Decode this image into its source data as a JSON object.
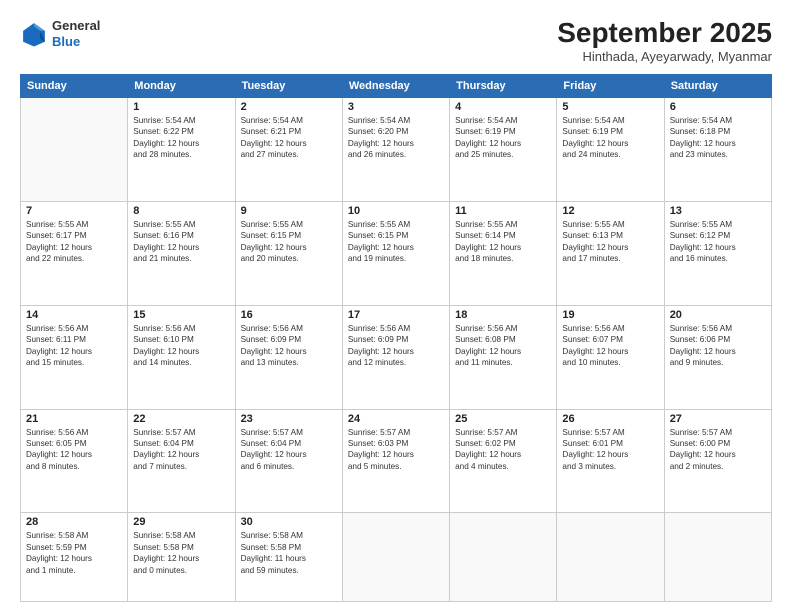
{
  "logo": {
    "general": "General",
    "blue": "Blue"
  },
  "header": {
    "month": "September 2025",
    "location": "Hinthada, Ayeyarwady, Myanmar"
  },
  "weekdays": [
    "Sunday",
    "Monday",
    "Tuesday",
    "Wednesday",
    "Thursday",
    "Friday",
    "Saturday"
  ],
  "weeks": [
    [
      {
        "day": "",
        "info": ""
      },
      {
        "day": "1",
        "info": "Sunrise: 5:54 AM\nSunset: 6:22 PM\nDaylight: 12 hours\nand 28 minutes."
      },
      {
        "day": "2",
        "info": "Sunrise: 5:54 AM\nSunset: 6:21 PM\nDaylight: 12 hours\nand 27 minutes."
      },
      {
        "day": "3",
        "info": "Sunrise: 5:54 AM\nSunset: 6:20 PM\nDaylight: 12 hours\nand 26 minutes."
      },
      {
        "day": "4",
        "info": "Sunrise: 5:54 AM\nSunset: 6:19 PM\nDaylight: 12 hours\nand 25 minutes."
      },
      {
        "day": "5",
        "info": "Sunrise: 5:54 AM\nSunset: 6:19 PM\nDaylight: 12 hours\nand 24 minutes."
      },
      {
        "day": "6",
        "info": "Sunrise: 5:54 AM\nSunset: 6:18 PM\nDaylight: 12 hours\nand 23 minutes."
      }
    ],
    [
      {
        "day": "7",
        "info": "Sunrise: 5:55 AM\nSunset: 6:17 PM\nDaylight: 12 hours\nand 22 minutes."
      },
      {
        "day": "8",
        "info": "Sunrise: 5:55 AM\nSunset: 6:16 PM\nDaylight: 12 hours\nand 21 minutes."
      },
      {
        "day": "9",
        "info": "Sunrise: 5:55 AM\nSunset: 6:15 PM\nDaylight: 12 hours\nand 20 minutes."
      },
      {
        "day": "10",
        "info": "Sunrise: 5:55 AM\nSunset: 6:15 PM\nDaylight: 12 hours\nand 19 minutes."
      },
      {
        "day": "11",
        "info": "Sunrise: 5:55 AM\nSunset: 6:14 PM\nDaylight: 12 hours\nand 18 minutes."
      },
      {
        "day": "12",
        "info": "Sunrise: 5:55 AM\nSunset: 6:13 PM\nDaylight: 12 hours\nand 17 minutes."
      },
      {
        "day": "13",
        "info": "Sunrise: 5:55 AM\nSunset: 6:12 PM\nDaylight: 12 hours\nand 16 minutes."
      }
    ],
    [
      {
        "day": "14",
        "info": "Sunrise: 5:56 AM\nSunset: 6:11 PM\nDaylight: 12 hours\nand 15 minutes."
      },
      {
        "day": "15",
        "info": "Sunrise: 5:56 AM\nSunset: 6:10 PM\nDaylight: 12 hours\nand 14 minutes."
      },
      {
        "day": "16",
        "info": "Sunrise: 5:56 AM\nSunset: 6:09 PM\nDaylight: 12 hours\nand 13 minutes."
      },
      {
        "day": "17",
        "info": "Sunrise: 5:56 AM\nSunset: 6:09 PM\nDaylight: 12 hours\nand 12 minutes."
      },
      {
        "day": "18",
        "info": "Sunrise: 5:56 AM\nSunset: 6:08 PM\nDaylight: 12 hours\nand 11 minutes."
      },
      {
        "day": "19",
        "info": "Sunrise: 5:56 AM\nSunset: 6:07 PM\nDaylight: 12 hours\nand 10 minutes."
      },
      {
        "day": "20",
        "info": "Sunrise: 5:56 AM\nSunset: 6:06 PM\nDaylight: 12 hours\nand 9 minutes."
      }
    ],
    [
      {
        "day": "21",
        "info": "Sunrise: 5:56 AM\nSunset: 6:05 PM\nDaylight: 12 hours\nand 8 minutes."
      },
      {
        "day": "22",
        "info": "Sunrise: 5:57 AM\nSunset: 6:04 PM\nDaylight: 12 hours\nand 7 minutes."
      },
      {
        "day": "23",
        "info": "Sunrise: 5:57 AM\nSunset: 6:04 PM\nDaylight: 12 hours\nand 6 minutes."
      },
      {
        "day": "24",
        "info": "Sunrise: 5:57 AM\nSunset: 6:03 PM\nDaylight: 12 hours\nand 5 minutes."
      },
      {
        "day": "25",
        "info": "Sunrise: 5:57 AM\nSunset: 6:02 PM\nDaylight: 12 hours\nand 4 minutes."
      },
      {
        "day": "26",
        "info": "Sunrise: 5:57 AM\nSunset: 6:01 PM\nDaylight: 12 hours\nand 3 minutes."
      },
      {
        "day": "27",
        "info": "Sunrise: 5:57 AM\nSunset: 6:00 PM\nDaylight: 12 hours\nand 2 minutes."
      }
    ],
    [
      {
        "day": "28",
        "info": "Sunrise: 5:58 AM\nSunset: 5:59 PM\nDaylight: 12 hours\nand 1 minute."
      },
      {
        "day": "29",
        "info": "Sunrise: 5:58 AM\nSunset: 5:58 PM\nDaylight: 12 hours\nand 0 minutes."
      },
      {
        "day": "30",
        "info": "Sunrise: 5:58 AM\nSunset: 5:58 PM\nDaylight: 11 hours\nand 59 minutes."
      },
      {
        "day": "",
        "info": ""
      },
      {
        "day": "",
        "info": ""
      },
      {
        "day": "",
        "info": ""
      },
      {
        "day": "",
        "info": ""
      }
    ]
  ]
}
